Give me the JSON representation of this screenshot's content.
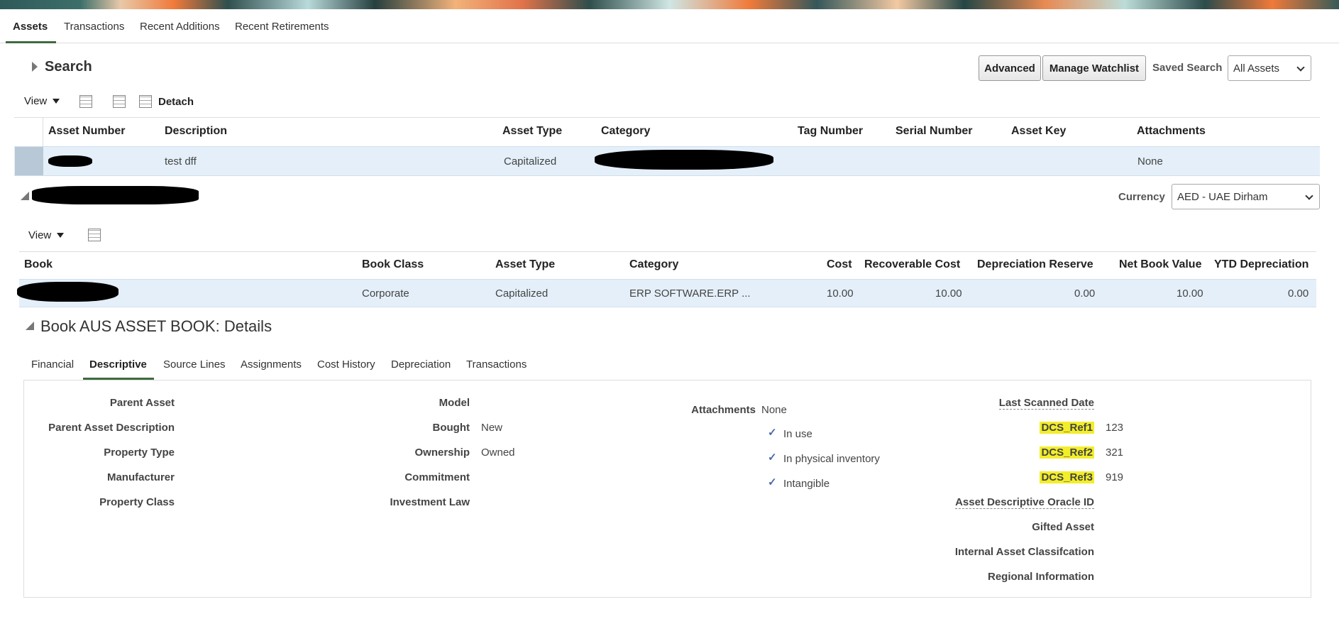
{
  "top_tabs": [
    "Assets",
    "Transactions",
    "Recent Additions",
    "Recent Retirements"
  ],
  "search": {
    "title": "Search",
    "advanced_label": "Advanced",
    "watchlist_label": "Manage Watchlist",
    "saved_search_label": "Saved Search",
    "saved_search_value": "All Assets"
  },
  "toolbar1": {
    "view_label": "View",
    "detach_label": "Detach"
  },
  "assets_table": {
    "headers": [
      "Asset Number",
      "Description",
      "Asset Type",
      "Category",
      "Tag Number",
      "Serial Number",
      "Asset Key",
      "Attachments"
    ],
    "row": {
      "description": "test dff",
      "asset_type": "Capitalized",
      "attachments": "None"
    }
  },
  "currency": {
    "label": "Currency",
    "value": "AED - UAE Dirham"
  },
  "toolbar2": {
    "view_label": "View"
  },
  "books_table": {
    "headers": [
      "Book",
      "Book Class",
      "Asset Type",
      "Category",
      "Cost",
      "Recoverable Cost",
      "Depreciation Reserve",
      "Net Book Value",
      "YTD Depreciation"
    ],
    "row": {
      "book_class": "Corporate",
      "asset_type": "Capitalized",
      "category": "ERP SOFTWARE.ERP ...",
      "cost": "10.00",
      "recoverable_cost": "10.00",
      "depreciation_reserve": "0.00",
      "net_book_value": "10.00",
      "ytd_depreciation": "0.00"
    }
  },
  "details": {
    "title": "Book AUS ASSET BOOK: Details",
    "tabs": [
      "Financial",
      "Descriptive",
      "Source Lines",
      "Assignments",
      "Cost History",
      "Depreciation",
      "Transactions"
    ],
    "col1_labels": [
      "Parent Asset",
      "Parent Asset Description",
      "Property Type",
      "Manufacturer",
      "Property Class"
    ],
    "col2_labels": [
      "Model",
      "Bought",
      "Ownership",
      "Commitment",
      "Investment Law"
    ],
    "col2_values": {
      "bought": "New",
      "ownership": "Owned"
    },
    "attachments_label": "Attachments",
    "attachments_value": "None",
    "checks": [
      "In use",
      "In physical inventory",
      "Intangible"
    ],
    "col4_labels": [
      "Last Scanned Date",
      "DCS_Ref1",
      "DCS_Ref2",
      "DCS_Ref3",
      "Asset Descriptive Oracle ID",
      "Gifted Asset",
      "Internal Asset Classifcation",
      "Regional Information"
    ],
    "col4_values": {
      "dcs_ref1": "123",
      "dcs_ref2": "321",
      "dcs_ref3": "919"
    }
  },
  "colors": {
    "accent_underline": "#3e6b3e",
    "selected_row": "#e4eff9",
    "highlight": "#f2ee2a",
    "check": "#4a6aa8"
  }
}
